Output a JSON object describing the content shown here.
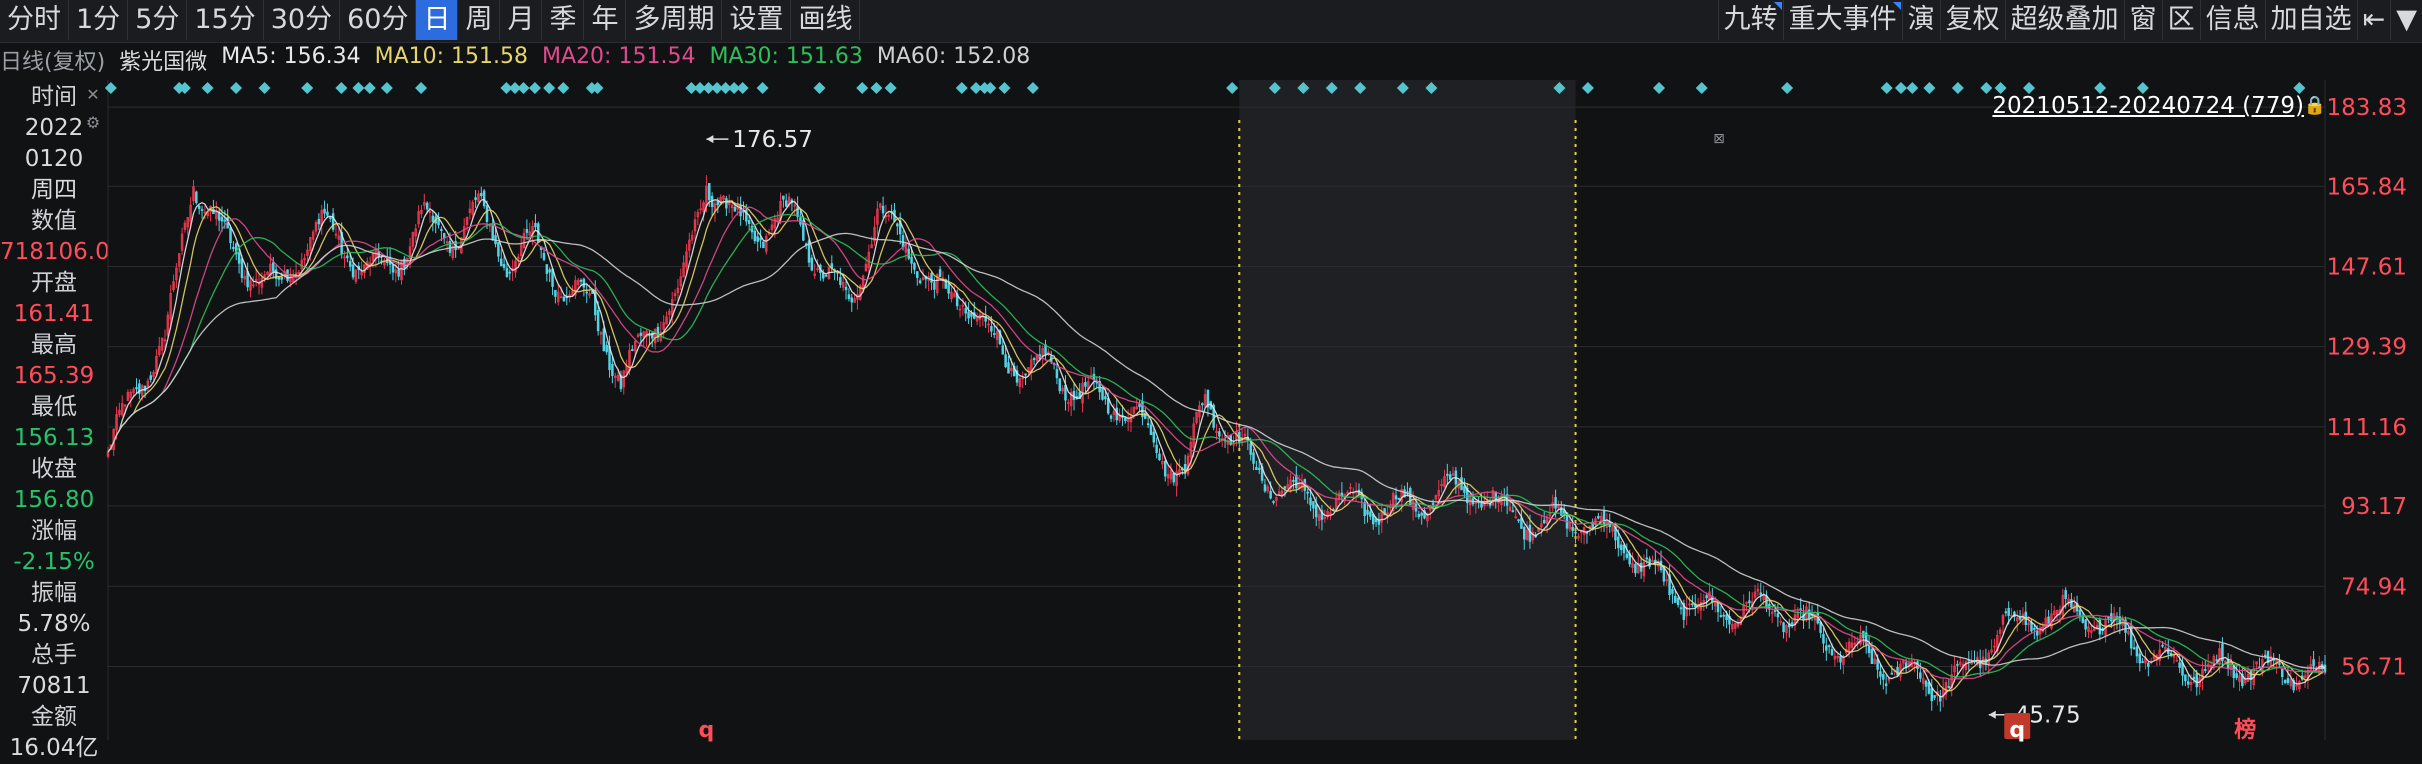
{
  "toolbar": {
    "tabs": [
      "分时",
      "1分",
      "5分",
      "15分",
      "30分",
      "60分",
      "日",
      "周",
      "月",
      "季",
      "年",
      "多周期",
      "设置",
      "画线"
    ],
    "active_tab": "日",
    "right_tools": [
      "九转",
      "重大事件",
      "演",
      "复权",
      "超级叠加",
      "窗",
      "区",
      "信息",
      "加自选",
      "⇤",
      "▼"
    ]
  },
  "ma": {
    "prefix": "日线(复权)",
    "name": "紫光国微",
    "ma5": "MA5: 156.34",
    "ma10": "MA10: 151.58",
    "ma20": "MA20: 151.54",
    "ma30": "MA30: 151.63",
    "ma60": "MA60: 152.08",
    "colors": {
      "ma5": "#e8e8e8",
      "ma10": "#e6d56a",
      "ma20": "#e04a8f",
      "ma30": "#2fbf5a",
      "ma60": "#d0d0d0"
    }
  },
  "info_panel": {
    "time_label": "时间",
    "year": "2022",
    "date": "0120",
    "weekday": "周四",
    "value_label": "数值",
    "value": "718106.00",
    "open_label": "开盘",
    "open": "161.41",
    "high_label": "最高",
    "high": "165.39",
    "low_label": "最低",
    "low": "156.13",
    "close_label": "收盘",
    "close": "156.80",
    "change_label": "涨幅",
    "change": "-2.15%",
    "amplitude_label": "振幅",
    "amplitude": "5.78%",
    "volume_label": "总手",
    "volume": "70811",
    "amount_label": "金额",
    "amount": "16.04亿"
  },
  "range_label": "20210512-20240724 (779)",
  "bottom_markers": [
    "q",
    "q",
    "榜"
  ],
  "chart_data": {
    "type": "line",
    "title": "",
    "ylim": [
      40,
      190
    ],
    "y_ticks": [
      "183.83",
      "165.84",
      "147.61",
      "129.39",
      "111.16",
      "93.17",
      "74.94",
      "56.71"
    ],
    "y_tick_values": [
      183.83,
      165.84,
      147.61,
      129.39,
      111.16,
      93.17,
      74.94,
      56.71
    ],
    "annotations": [
      {
        "label": "176.57",
        "bar": 210,
        "value": 176.57
      },
      {
        "label": "45.75",
        "bar": 660,
        "value": 45.75
      }
    ],
    "total_bars": 779,
    "close_anchors": [
      [
        0,
        105
      ],
      [
        10,
        118
      ],
      [
        20,
        128
      ],
      [
        30,
        168
      ],
      [
        45,
        152
      ],
      [
        60,
        142
      ],
      [
        75,
        155
      ],
      [
        90,
        148
      ],
      [
        100,
        150
      ],
      [
        110,
        160
      ],
      [
        120,
        152
      ],
      [
        130,
        158
      ],
      [
        140,
        148
      ],
      [
        150,
        155
      ],
      [
        160,
        145
      ],
      [
        170,
        140
      ],
      [
        180,
        118
      ],
      [
        190,
        132
      ],
      [
        200,
        140
      ],
      [
        210,
        170
      ],
      [
        220,
        160
      ],
      [
        230,
        155
      ],
      [
        240,
        158
      ],
      [
        250,
        145
      ],
      [
        260,
        140
      ],
      [
        270,
        162
      ],
      [
        280,
        155
      ],
      [
        290,
        140
      ],
      [
        300,
        138
      ],
      [
        310,
        130
      ],
      [
        320,
        125
      ],
      [
        330,
        128
      ],
      [
        340,
        120
      ],
      [
        350,
        115
      ],
      [
        360,
        112
      ],
      [
        370,
        104
      ],
      [
        378,
        103
      ],
      [
        385,
        120
      ],
      [
        395,
        110
      ],
      [
        405,
        98
      ],
      [
        420,
        92
      ],
      [
        440,
        96
      ],
      [
        460,
        93
      ],
      [
        480,
        95
      ],
      [
        500,
        92
      ],
      [
        515,
        90
      ],
      [
        525,
        85
      ],
      [
        540,
        78
      ],
      [
        560,
        72
      ],
      [
        580,
        68
      ],
      [
        600,
        64
      ],
      [
        615,
        62
      ],
      [
        630,
        55
      ],
      [
        640,
        50
      ],
      [
        650,
        52
      ],
      [
        665,
        68
      ],
      [
        680,
        70
      ],
      [
        700,
        64
      ],
      [
        720,
        60
      ],
      [
        740,
        57
      ],
      [
        760,
        53
      ],
      [
        770,
        55
      ],
      [
        779,
        56
      ]
    ],
    "ma_series": [
      {
        "name": "MA5",
        "window": 5
      },
      {
        "name": "MA10",
        "window": 10
      },
      {
        "name": "MA20",
        "window": 20
      },
      {
        "name": "MA30",
        "window": 30
      },
      {
        "name": "MA60",
        "window": 60
      }
    ],
    "shaded_range_bars": [
      397,
      515
    ],
    "up_color": "#e8384f",
    "down_color": "#53d4e6",
    "event_dot_color": "#56c4cf"
  }
}
